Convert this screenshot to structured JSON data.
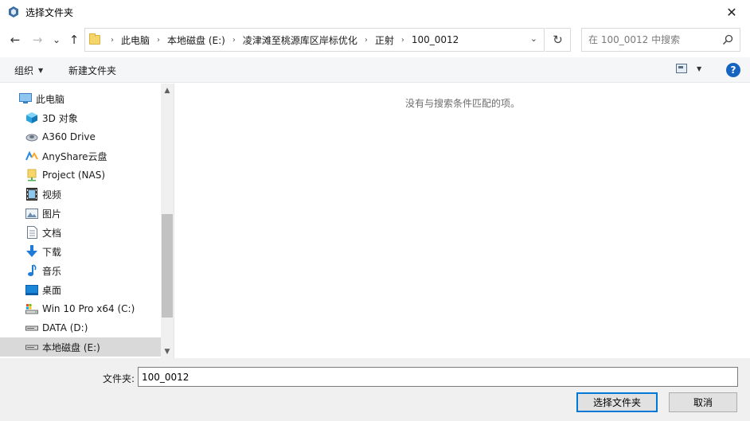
{
  "window": {
    "title": "选择文件夹",
    "close_glyph": "✕"
  },
  "nav": {
    "back_glyph": "←",
    "forward_glyph": "→",
    "recent_glyph": "⌄",
    "up_glyph": "↑",
    "refresh_glyph": "↻",
    "dropdown_glyph": "⌄",
    "breadcrumb_sep": "›",
    "breadcrumbs": [
      "此电脑",
      "本地磁盘 (E:)",
      "凌津滩至桃源库区岸标优化",
      "正射",
      "100_0012"
    ]
  },
  "search": {
    "placeholder": "在 100_0012 中搜索"
  },
  "toolbar": {
    "organize_label": "组织",
    "new_folder_label": "新建文件夹",
    "caret": "▼",
    "help_label": "?"
  },
  "tree": {
    "items": [
      {
        "label": "此电脑",
        "icon": "computer-icon"
      },
      {
        "label": "3D 对象",
        "icon": "cube-3d-icon"
      },
      {
        "label": "A360 Drive",
        "icon": "cloud-drive-icon"
      },
      {
        "label": "AnyShare云盘",
        "icon": "anyshare-icon"
      },
      {
        "label": "Project (NAS)",
        "icon": "nas-icon"
      },
      {
        "label": "视频",
        "icon": "video-icon"
      },
      {
        "label": "图片",
        "icon": "pictures-icon"
      },
      {
        "label": "文档",
        "icon": "documents-icon"
      },
      {
        "label": "下载",
        "icon": "download-icon"
      },
      {
        "label": "音乐",
        "icon": "music-icon"
      },
      {
        "label": "桌面",
        "icon": "desktop-icon"
      },
      {
        "label": "Win 10 Pro x64 (C:)",
        "icon": "system-drive-icon"
      },
      {
        "label": "DATA (D:)",
        "icon": "drive-icon"
      },
      {
        "label": "本地磁盘 (E:)",
        "icon": "drive-icon"
      }
    ],
    "selected_index": 13,
    "scroll_up_glyph": "▲",
    "scroll_down_glyph": "▼"
  },
  "content": {
    "empty_message": "没有与搜索条件匹配的项。"
  },
  "footer": {
    "folder_label": "文件夹:",
    "folder_value": "100_0012",
    "select_button": "选择文件夹",
    "cancel_button": "取消"
  },
  "colors": {
    "accent": "#0078d7",
    "selection": "#d9d9d9",
    "help": "#1565c0"
  }
}
